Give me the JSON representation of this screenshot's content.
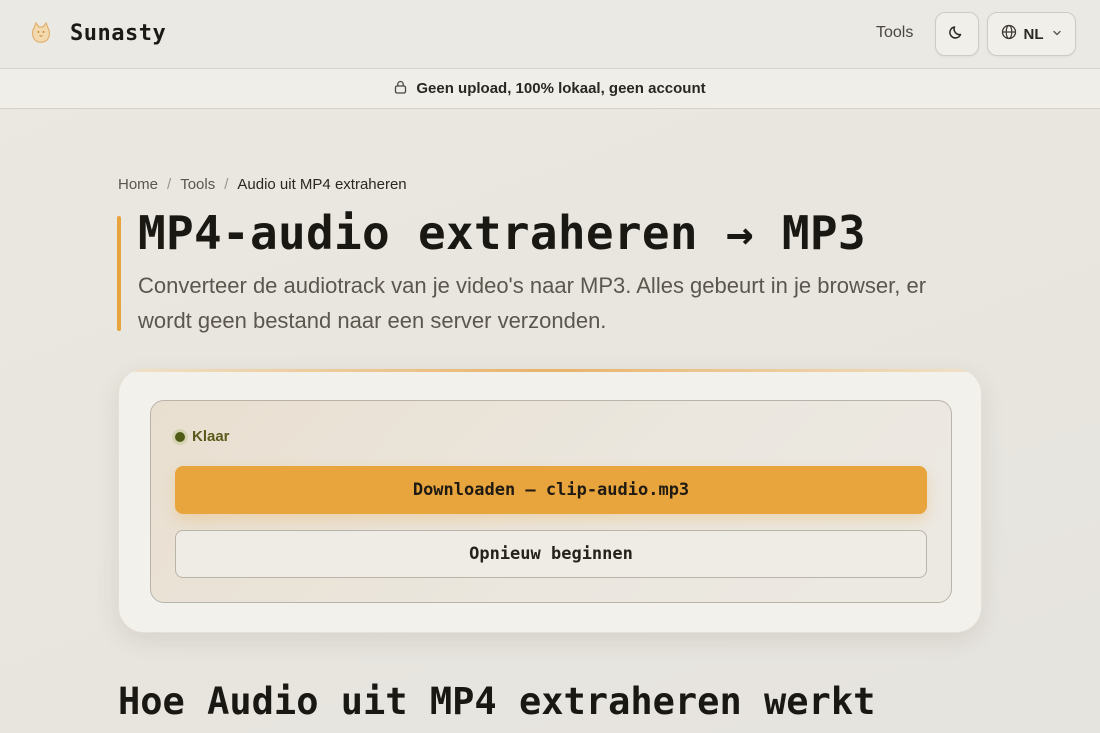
{
  "header": {
    "brand_name": "Sunasty",
    "nav_tools": "Tools",
    "lang_label": "NL"
  },
  "notice": {
    "text": "Geen upload, 100% lokaal, geen account"
  },
  "breadcrumb": {
    "home": "Home",
    "tools": "Tools",
    "current": "Audio uit MP4 extraheren"
  },
  "hero": {
    "title": "MP4-audio extraheren → MP3",
    "subtitle": "Converteer de audiotrack van je video's naar MP3. Alles gebeurt in je browser, er wordt geen bestand naar een server verzonden."
  },
  "result": {
    "status": "Klaar",
    "download_label": "Downloaden — clip-audio.mp3",
    "restart_label": "Opnieuw beginnen"
  },
  "section": {
    "title": "Hoe Audio uit MP4 extraheren werkt"
  },
  "colors": {
    "accent": "#e8a43d",
    "status_dot": "#4f5a16"
  },
  "icons": [
    "cat-logo-icon",
    "moon-icon",
    "globe-icon",
    "chevron-down-icon",
    "lock-icon"
  ]
}
